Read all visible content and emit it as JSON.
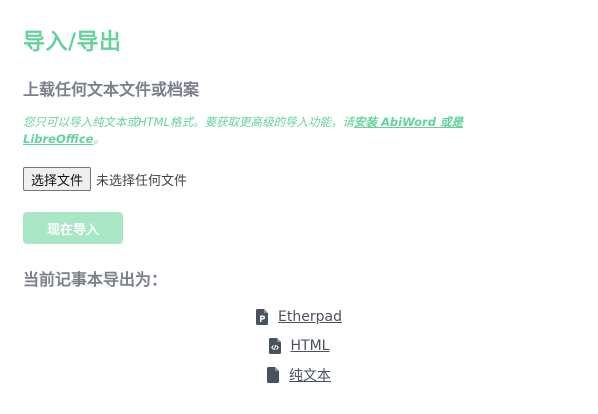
{
  "header": {
    "title": "导入/导出",
    "import_subtitle": "上载任何文本文件或档案"
  },
  "import": {
    "hint_text": "您只可以导入纯文本或HTML格式。要获取更高级的导入功能，请",
    "hint_link": "安装 AbiWord 或是 LibreOffice",
    "hint_end": "。",
    "choose_file_label": "选择文件",
    "no_file_text": "未选择任何文件",
    "import_button_label": "现在导入"
  },
  "export": {
    "title": "当前记事本导出为：",
    "items": [
      {
        "label": "Etherpad",
        "icon": "file-etherpad-icon"
      },
      {
        "label": "HTML",
        "icon": "file-code-icon"
      },
      {
        "label": "纯文本",
        "icon": "file-text-icon"
      }
    ]
  },
  "colors": {
    "accent": "#64d29b",
    "button_disabled": "#a8e6c6",
    "heading_gray": "#7a818c",
    "link_gray": "#4a5260"
  }
}
